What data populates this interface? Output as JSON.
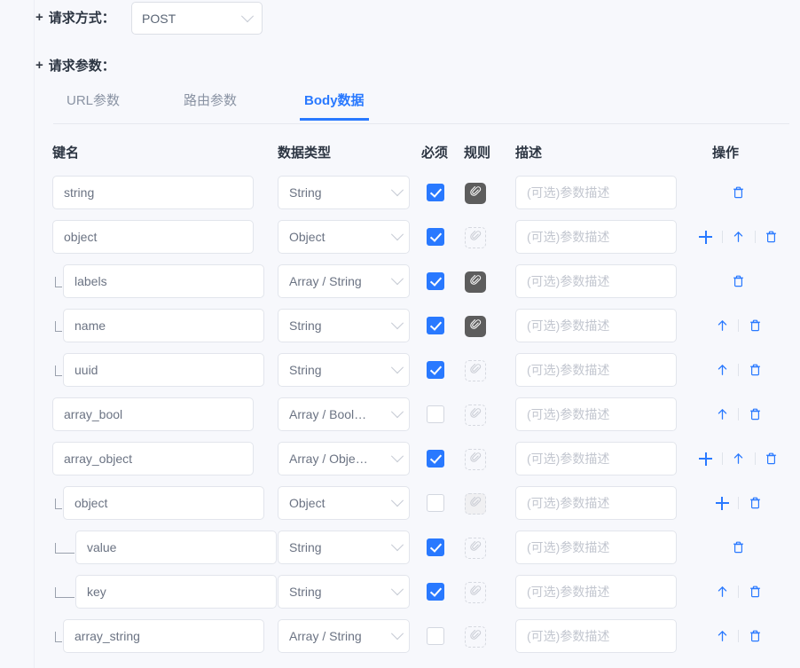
{
  "sections": {
    "method": {
      "plus": "+",
      "label": "请求方式",
      "colon": "："
    },
    "params": {
      "plus": "+",
      "label": "请求参数",
      "colon": "："
    }
  },
  "method_select": {
    "value": "POST",
    "icon": "chevron-down-icon"
  },
  "tabs": [
    {
      "label": "URL参数",
      "active": false
    },
    {
      "label": "路由参数",
      "active": false
    },
    {
      "label": "Body数据",
      "active": true
    }
  ],
  "table": {
    "headers": {
      "key": "键名",
      "type": "数据类型",
      "required": "必须",
      "rule": "规则",
      "desc": "描述",
      "ops": "操作"
    },
    "desc_placeholder": "(可选)参数描述",
    "rows": [
      {
        "key": "string",
        "type": "String",
        "depth": 0,
        "required": true,
        "rule": "active",
        "ops": [
          "delete"
        ]
      },
      {
        "key": "object",
        "type": "Object",
        "depth": 0,
        "required": true,
        "rule": "dashed",
        "ops": [
          "add",
          "up",
          "delete"
        ]
      },
      {
        "key": "labels",
        "type": "Array / String",
        "depth": 1,
        "required": true,
        "rule": "active",
        "ops": [
          "delete"
        ]
      },
      {
        "key": "name",
        "type": "String",
        "depth": 1,
        "required": true,
        "rule": "active",
        "ops": [
          "up",
          "delete"
        ]
      },
      {
        "key": "uuid",
        "type": "String",
        "depth": 1,
        "required": true,
        "rule": "dashed",
        "ops": [
          "up",
          "delete"
        ]
      },
      {
        "key": "array_bool",
        "type": "Array / Bool…",
        "depth": 0,
        "required": false,
        "rule": "dashed",
        "ops": [
          "up",
          "delete"
        ]
      },
      {
        "key": "array_object",
        "type": "Array / Obje…",
        "depth": 0,
        "required": true,
        "rule": "dashed",
        "ops": [
          "add",
          "up",
          "delete"
        ]
      },
      {
        "key": "object",
        "type": "Object",
        "depth": 1,
        "required": false,
        "rule": "filled",
        "ops": [
          "add",
          "delete"
        ]
      },
      {
        "key": "value",
        "type": "String",
        "depth": 2,
        "required": true,
        "rule": "dashed",
        "ops": [
          "delete"
        ]
      },
      {
        "key": "key",
        "type": "String",
        "depth": 2,
        "required": true,
        "rule": "dashed",
        "ops": [
          "up",
          "delete"
        ]
      },
      {
        "key": "array_string",
        "type": "Array / String",
        "depth": 1,
        "required": false,
        "rule": "dashed",
        "ops": [
          "up",
          "delete"
        ]
      }
    ]
  },
  "colors": {
    "accent": "#2979ff",
    "background": "#f7f8fc",
    "field_border": "#e2e5ec",
    "text": "#2c3542",
    "muted": "#6b7383",
    "placeholder": "#c2c6cf",
    "rule_active_bg": "#5d5d5d"
  },
  "icons": {
    "add": "plus-icon",
    "up": "arrow-up-icon",
    "delete": "trash-icon",
    "rule": "paperclip-icon",
    "chevron": "chevron-down-icon"
  }
}
